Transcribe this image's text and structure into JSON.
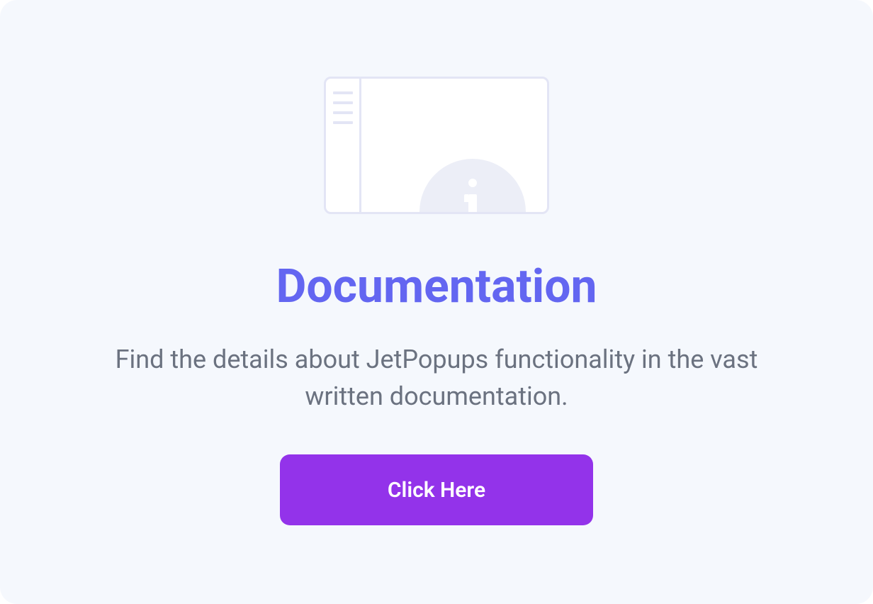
{
  "heading": "Documentation",
  "description": "Find the details about JetPopups functionality in the vast written documentation.",
  "button_label": "Click Here"
}
